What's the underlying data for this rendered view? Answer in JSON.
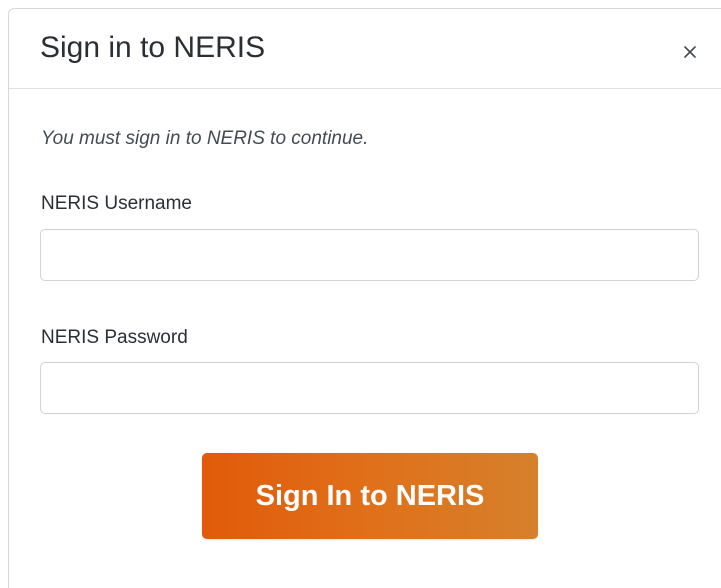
{
  "modal": {
    "title": "Sign in to NERIS",
    "close_icon": "close-icon"
  },
  "body": {
    "notice": "You must sign in to NERIS to continue.",
    "username": {
      "label": "NERIS Username",
      "value": "",
      "placeholder": ""
    },
    "password": {
      "label": "NERIS Password",
      "value": "",
      "placeholder": ""
    },
    "submit_label": "Sign In to NERIS"
  },
  "colors": {
    "button_gradient_start": "#e15a0a",
    "button_gradient_end": "#d6802c",
    "button_text": "#ffffff",
    "border": "#ced4da"
  }
}
